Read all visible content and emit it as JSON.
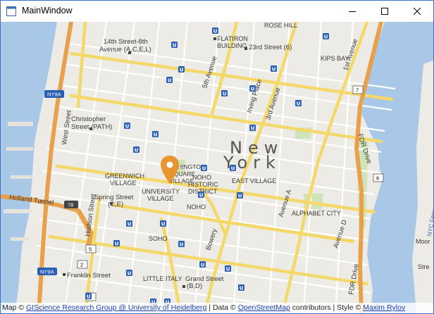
{
  "window": {
    "title": "MainWindow",
    "icon": "app-window-icon",
    "controls": [
      "minimize-icon",
      "maximize-icon",
      "close-icon"
    ]
  },
  "map": {
    "city_label_1": "New",
    "city_label_2": "York",
    "neighborhoods": {
      "greenwich_village": "GREENWICH\nVILLAGE",
      "university_village": "UNIVERSITY\nVILLAGE",
      "washington_square": "WASHINGTON\nSQUARE\nVILLAGE",
      "noho_historic": "NOHO\nHISTORIC\nDISTRICT",
      "noho": "NOHO",
      "east_village": "EAST VILLAGE",
      "soho": "SOHO",
      "little_italy": "LITTLE ITALY",
      "alphabet_city": "ALPHABET CITY",
      "kips_bay": "KIPS BAY",
      "rose_hill": "ROSE HILL",
      "flatiron": "FLATIRON\nBUILDING"
    },
    "stations": {
      "14th": "14th Street-8th\nAvenue (A,C,E,L)",
      "23rd": "23rd Street (6)",
      "christopher": "Christopher\nStreet (PATH)",
      "spring": "Spring Street\n(C,E)",
      "franklin": "Franklin Street",
      "grand": "Grand Street\n(B,D)"
    },
    "streets": {
      "west": "West Street",
      "hudson": "Hudson Street",
      "fifth": "5th Avenue",
      "irving": "Irving Place",
      "third": "3rd Avenue",
      "first": "1st Avenue",
      "fdr": "FDR Drive",
      "fdr2": "FDR Drive",
      "bowery": "Bowery",
      "ave_a": "Avenue A",
      "ave_d": "Avenue D",
      "holland": "Holland Tunnel",
      "nyc_ferry": "NYC Ferry"
    },
    "shields": {
      "ny9a_1": "NY9A",
      "ny9a_2": "NY9A",
      "i78": "78",
      "r5a": "5",
      "r5b": "5",
      "r2": "2",
      "r6": "6",
      "r7": "7"
    },
    "edge_labels": {
      "moor": "Moor",
      "stre": "Stre"
    }
  },
  "attribution": {
    "prefix": "Map ©",
    "link1": "GIScience Research Group @ University of Heidelberg",
    "mid": "| Data ©",
    "link2": "OpenStreetMap",
    "mid2": "contributors | Style ©",
    "link3": "Maxim Rylov"
  },
  "colors": {
    "land": "#ecebe5",
    "water": "#a9c7e7",
    "highway": "#e8a04c",
    "major_road": "#f4d86a",
    "pin": "#e8942f",
    "window_border": "#3d6fc2"
  }
}
